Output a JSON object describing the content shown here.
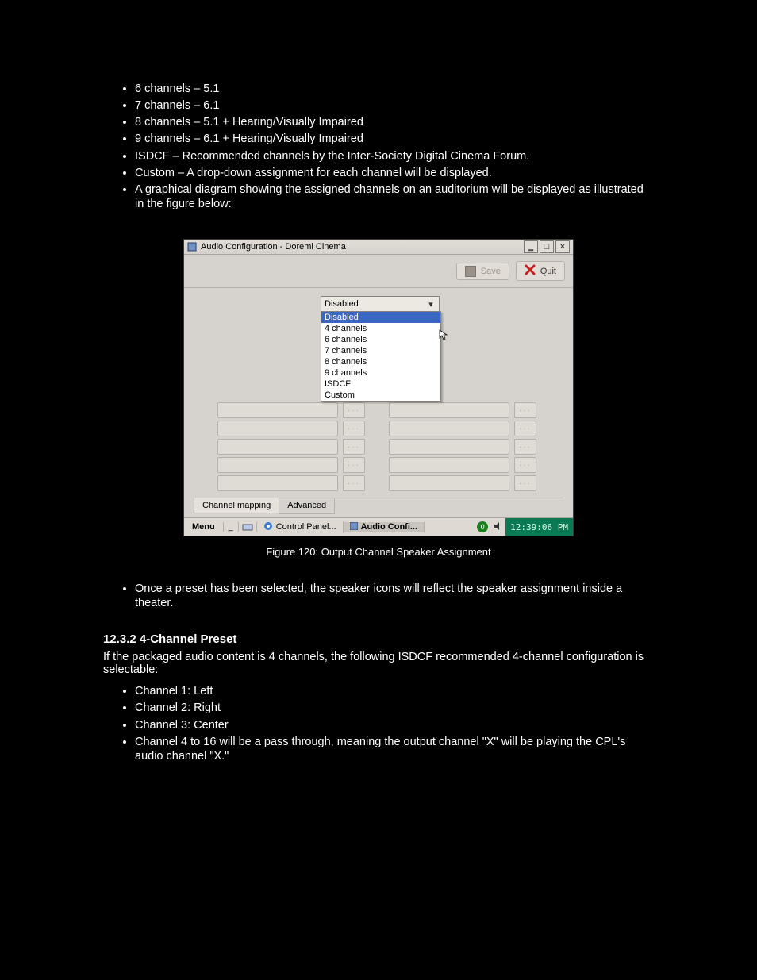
{
  "bullets_top": [
    "6 channels – 5.1",
    "7 channels – 6.1",
    "8 channels – 5.1 + Hearing/Visually Impaired",
    "9 channels – 6.1 + Hearing/Visually Impaired",
    "ISDCF – Recommended channels by the Inter-Society Digital Cinema Forum.",
    "Custom – A drop-down assignment for each channel will be displayed.",
    "A graphical diagram showing the assigned channels on an auditorium will be displayed as illustrated in the figure below:"
  ],
  "window": {
    "title": "Audio Configuration - Doremi Cinema",
    "save": "Save",
    "quit": "Quit",
    "dropdown_value": "Disabled",
    "dropdown_items": [
      "Disabled",
      "4 channels",
      "6 channels",
      "7 channels",
      "8 channels",
      "9 channels",
      "ISDCF",
      "Custom"
    ],
    "tabs": {
      "a": "Channel mapping",
      "b": "Advanced"
    },
    "taskbar": {
      "menu": "Menu",
      "task1": "Control Panel...",
      "task2": "Audio Confi...",
      "clock": "12:39:06 PM",
      "indicator": "0"
    },
    "ellipsis": "···"
  },
  "caption": "Figure 120: Output Channel Speaker Assignment",
  "after_bullets": [
    "Once a preset has been selected, the speaker icons will reflect the speaker assignment inside a theater."
  ],
  "sec_title": "12.3.2  4-Channel Preset",
  "sec_p": "If the packaged audio content is 4 channels, the following ISDCF recommended 4-channel configuration is selectable:",
  "bullets_bottom": [
    "Channel 1: Left",
    "Channel 2: Right",
    "Channel 3: Center",
    "Channel 4 to 16 will be a pass through, meaning the output channel \"X\" will be playing the CPL's audio channel \"X.\""
  ]
}
